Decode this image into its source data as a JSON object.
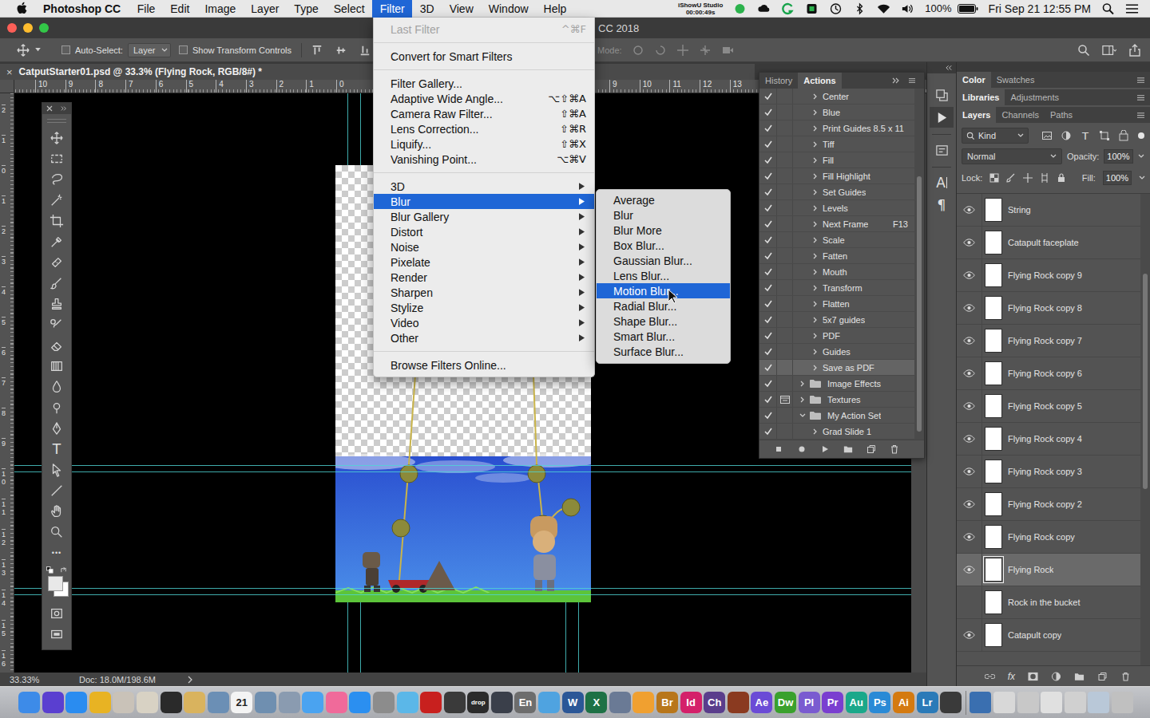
{
  "menubar": {
    "app_name": "Photoshop CC",
    "menus": [
      {
        "label": "File",
        "selected": false
      },
      {
        "label": "Edit",
        "selected": false
      },
      {
        "label": "Image",
        "selected": false
      },
      {
        "label": "Layer",
        "selected": false
      },
      {
        "label": "Type",
        "selected": false
      },
      {
        "label": "Select",
        "selected": false
      },
      {
        "label": "Filter",
        "selected": true
      },
      {
        "label": "3D",
        "selected": false
      },
      {
        "label": "View",
        "selected": false
      },
      {
        "label": "Window",
        "selected": false
      },
      {
        "label": "Help",
        "selected": false
      }
    ],
    "recorder": {
      "name": "iShowU Studio",
      "time": "00:00:49s"
    },
    "battery": "100%",
    "clock": "Fri Sep 21 12:55 PM"
  },
  "app_window": {
    "title": "CC 2018"
  },
  "options_bar": {
    "auto_select_label": "Auto-Select:",
    "auto_select_checked": false,
    "auto_select_target": "Layer",
    "transform_controls_label": "Show Transform Controls",
    "transform_controls_checked": false,
    "mode_label": "Mode:"
  },
  "document": {
    "tab_title": "CatputStarter01.psd @ 33.3% (Flying Rock, RGB/8#) *",
    "close": "×"
  },
  "rulers": {
    "top_left": [
      "10",
      "9",
      "8",
      "7",
      "6",
      "5",
      "4",
      "3",
      "2",
      "1",
      "0"
    ],
    "top_right": [
      "9",
      "10",
      "11",
      "12",
      "13"
    ],
    "left": [
      "2",
      "1",
      "0",
      "1",
      "2",
      "3",
      "4",
      "5",
      "6",
      "7",
      "8",
      "9",
      "10",
      "11",
      "12",
      "13",
      "14",
      "15",
      "16"
    ]
  },
  "toolbox": {
    "type_tool": "T",
    "more_tools": "•••"
  },
  "status_bar": {
    "zoom": "33.33%",
    "doc_size": "Doc: 18.0M/198.6M"
  },
  "filter_menu": {
    "items": [
      {
        "kind": "item",
        "label": "Last Filter",
        "shortcut": "^⌘F",
        "disabled": true,
        "submenu": false,
        "selected": false
      },
      {
        "kind": "separator"
      },
      {
        "kind": "item",
        "label": "Convert for Smart Filters",
        "shortcut": "",
        "disabled": false,
        "submenu": false,
        "selected": false
      },
      {
        "kind": "separator"
      },
      {
        "kind": "item",
        "label": "Filter Gallery...",
        "shortcut": "",
        "disabled": false,
        "submenu": false,
        "selected": false
      },
      {
        "kind": "item",
        "label": "Adaptive Wide Angle...",
        "shortcut": "⌥⇧⌘A",
        "disabled": false,
        "submenu": false,
        "selected": false
      },
      {
        "kind": "item",
        "label": "Camera Raw Filter...",
        "shortcut": "⇧⌘A",
        "disabled": false,
        "submenu": false,
        "selected": false
      },
      {
        "kind": "item",
        "label": "Lens Correction...",
        "shortcut": "⇧⌘R",
        "disabled": false,
        "submenu": false,
        "selected": false
      },
      {
        "kind": "item",
        "label": "Liquify...",
        "shortcut": "⇧⌘X",
        "disabled": false,
        "submenu": false,
        "selected": false
      },
      {
        "kind": "item",
        "label": "Vanishing Point...",
        "shortcut": "⌥⌘V",
        "disabled": false,
        "submenu": false,
        "selected": false
      },
      {
        "kind": "separator"
      },
      {
        "kind": "item",
        "label": "3D",
        "shortcut": "",
        "disabled": false,
        "submenu": true,
        "selected": false
      },
      {
        "kind": "item",
        "label": "Blur",
        "shortcut": "",
        "disabled": false,
        "submenu": true,
        "selected": true
      },
      {
        "kind": "item",
        "label": "Blur Gallery",
        "shortcut": "",
        "disabled": false,
        "submenu": true,
        "selected": false
      },
      {
        "kind": "item",
        "label": "Distort",
        "shortcut": "",
        "disabled": false,
        "submenu": true,
        "selected": false
      },
      {
        "kind": "item",
        "label": "Noise",
        "shortcut": "",
        "disabled": false,
        "submenu": true,
        "selected": false
      },
      {
        "kind": "item",
        "label": "Pixelate",
        "shortcut": "",
        "disabled": false,
        "submenu": true,
        "selected": false
      },
      {
        "kind": "item",
        "label": "Render",
        "shortcut": "",
        "disabled": false,
        "submenu": true,
        "selected": false
      },
      {
        "kind": "item",
        "label": "Sharpen",
        "shortcut": "",
        "disabled": false,
        "submenu": true,
        "selected": false
      },
      {
        "kind": "item",
        "label": "Stylize",
        "shortcut": "",
        "disabled": false,
        "submenu": true,
        "selected": false
      },
      {
        "kind": "item",
        "label": "Video",
        "shortcut": "",
        "disabled": false,
        "submenu": true,
        "selected": false
      },
      {
        "kind": "item",
        "label": "Other",
        "shortcut": "",
        "disabled": false,
        "submenu": true,
        "selected": false
      },
      {
        "kind": "separator"
      },
      {
        "kind": "item",
        "label": "Browse Filters Online...",
        "shortcut": "",
        "disabled": false,
        "submenu": false,
        "selected": false
      }
    ]
  },
  "blur_submenu": {
    "items": [
      {
        "label": "Average",
        "selected": false
      },
      {
        "label": "Blur",
        "selected": false
      },
      {
        "label": "Blur More",
        "selected": false
      },
      {
        "label": "Box Blur...",
        "selected": false
      },
      {
        "label": "Gaussian Blur...",
        "selected": false
      },
      {
        "label": "Lens Blur...",
        "selected": false
      },
      {
        "label": "Motion Blur...",
        "selected": true
      },
      {
        "label": "Radial Blur...",
        "selected": false
      },
      {
        "label": "Shape Blur...",
        "selected": false
      },
      {
        "label": "Smart Blur...",
        "selected": false
      },
      {
        "label": "Surface Blur...",
        "selected": false
      }
    ]
  },
  "actions_panel": {
    "tabs": [
      {
        "label": "History",
        "selected": false
      },
      {
        "label": "Actions",
        "selected": true
      }
    ],
    "rows": [
      {
        "label": "Center",
        "kind": "action",
        "checked": true,
        "dialog": false,
        "expanded": false,
        "shortcut": "",
        "selected": false
      },
      {
        "label": "Blue",
        "kind": "action",
        "checked": true,
        "dialog": false,
        "expanded": false,
        "shortcut": "",
        "selected": false
      },
      {
        "label": "Print Guides 8.5 x 11",
        "kind": "action",
        "checked": true,
        "dialog": false,
        "expanded": false,
        "shortcut": "",
        "selected": false
      },
      {
        "label": "Tiff",
        "kind": "action",
        "checked": true,
        "dialog": false,
        "expanded": false,
        "shortcut": "",
        "selected": false
      },
      {
        "label": "Fill",
        "kind": "action",
        "checked": true,
        "dialog": false,
        "expanded": false,
        "shortcut": "",
        "selected": false
      },
      {
        "label": "Fill Highlight",
        "kind": "action",
        "checked": true,
        "dialog": false,
        "expanded": false,
        "shortcut": "",
        "selected": false
      },
      {
        "label": "Set Guides",
        "kind": "action",
        "checked": true,
        "dialog": false,
        "expanded": false,
        "shortcut": "",
        "selected": false
      },
      {
        "label": "Levels",
        "kind": "action",
        "checked": true,
        "dialog": false,
        "expanded": false,
        "shortcut": "",
        "selected": false
      },
      {
        "label": "Next Frame",
        "kind": "action",
        "checked": true,
        "dialog": false,
        "expanded": false,
        "shortcut": "F13",
        "selected": false
      },
      {
        "label": "Scale",
        "kind": "action",
        "checked": true,
        "dialog": false,
        "expanded": false,
        "shortcut": "",
        "selected": false
      },
      {
        "label": "Fatten",
        "kind": "action",
        "checked": true,
        "dialog": false,
        "expanded": false,
        "shortcut": "",
        "selected": false
      },
      {
        "label": "Mouth",
        "kind": "action",
        "checked": true,
        "dialog": false,
        "expanded": false,
        "shortcut": "",
        "selected": false
      },
      {
        "label": "Transform",
        "kind": "action",
        "checked": true,
        "dialog": false,
        "expanded": false,
        "shortcut": "",
        "selected": false
      },
      {
        "label": "Flatten",
        "kind": "action",
        "checked": true,
        "dialog": false,
        "expanded": false,
        "shortcut": "",
        "selected": false
      },
      {
        "label": "5x7 guides",
        "kind": "action",
        "checked": true,
        "dialog": false,
        "expanded": false,
        "shortcut": "",
        "selected": false
      },
      {
        "label": "PDF",
        "kind": "action",
        "checked": true,
        "dialog": false,
        "expanded": false,
        "shortcut": "",
        "selected": false
      },
      {
        "label": "Guides",
        "kind": "action",
        "checked": true,
        "dialog": false,
        "expanded": false,
        "shortcut": "",
        "selected": false
      },
      {
        "label": "Save as PDF",
        "kind": "action",
        "checked": true,
        "dialog": false,
        "expanded": false,
        "shortcut": "",
        "selected": true
      },
      {
        "label": "Image Effects",
        "kind": "set",
        "checked": true,
        "dialog": false,
        "expanded": false,
        "shortcut": "",
        "selected": false
      },
      {
        "label": "Textures",
        "kind": "set",
        "checked": true,
        "dialog": true,
        "expanded": false,
        "shortcut": "",
        "selected": false
      },
      {
        "label": "My Action Set",
        "kind": "set",
        "checked": true,
        "dialog": false,
        "expanded": true,
        "shortcut": "",
        "selected": false
      },
      {
        "label": "Grad Slide 1",
        "kind": "action",
        "checked": true,
        "dialog": false,
        "expanded": false,
        "shortcut": "",
        "selected": false
      }
    ]
  },
  "icon_column": {
    "character": "A",
    "paragraph": "¶"
  },
  "right_panel": {
    "tab_groups": [
      {
        "tabs": [
          {
            "label": "Color",
            "selected": true
          },
          {
            "label": "Swatches",
            "selected": false
          }
        ]
      },
      {
        "tabs": [
          {
            "label": "Libraries",
            "selected": true
          },
          {
            "label": "Adjustments",
            "selected": false
          }
        ]
      },
      {
        "tabs": [
          {
            "label": "Layers",
            "selected": true
          },
          {
            "label": "Channels",
            "selected": false
          },
          {
            "label": "Paths",
            "selected": false
          }
        ]
      }
    ],
    "filter_label": "Kind",
    "type_filter": "T",
    "blend_mode": "Normal",
    "opacity_label": "Opacity:",
    "opacity": "100%",
    "lock_label": "Lock:",
    "fill_label": "Fill:",
    "fill": "100%",
    "footer_fx": "fx",
    "layers": [
      {
        "name": "String",
        "visible": true,
        "selected": false
      },
      {
        "name": "Catapult faceplate",
        "visible": true,
        "selected": false
      },
      {
        "name": "Flying Rock copy 9",
        "visible": true,
        "selected": false
      },
      {
        "name": "Flying Rock copy 8",
        "visible": true,
        "selected": false
      },
      {
        "name": "Flying Rock copy 7",
        "visible": true,
        "selected": false
      },
      {
        "name": "Flying Rock copy 6",
        "visible": true,
        "selected": false
      },
      {
        "name": "Flying Rock copy 5",
        "visible": true,
        "selected": false
      },
      {
        "name": "Flying Rock copy 4",
        "visible": true,
        "selected": false
      },
      {
        "name": "Flying Rock copy 3",
        "visible": true,
        "selected": false
      },
      {
        "name": "Flying Rock copy 2",
        "visible": true,
        "selected": false
      },
      {
        "name": "Flying Rock copy",
        "visible": true,
        "selected": false
      },
      {
        "name": "Flying Rock",
        "visible": true,
        "selected": true
      },
      {
        "name": "Rock in the bucket",
        "visible": false,
        "selected": false
      },
      {
        "name": "Catapult copy",
        "visible": true,
        "selected": false
      }
    ]
  },
  "dock": {
    "apps": [
      {
        "label": "",
        "color": "#3d8be8"
      },
      {
        "label": "",
        "color": "#5a3fd0"
      },
      {
        "label": "",
        "color": "#2a8cf0"
      },
      {
        "label": "",
        "color": "#e8b323"
      },
      {
        "label": "",
        "color": "#c9c2b8"
      },
      {
        "label": "",
        "color": "#d8d2c4"
      },
      {
        "label": "",
        "color": "#2a2a2a"
      },
      {
        "label": "",
        "color": "#d9b35e"
      },
      {
        "label": "",
        "color": "#6b8fb5"
      },
      {
        "label": "21",
        "color": "#f4f4f4"
      },
      {
        "label": "",
        "color": "#6f8fb0"
      },
      {
        "label": "",
        "color": "#8a9bb0"
      },
      {
        "label": "",
        "color": "#4aa3f0"
      },
      {
        "label": "",
        "color": "#f06a9a"
      },
      {
        "label": "",
        "color": "#2b8ff0"
      },
      {
        "label": "",
        "color": "#8c8c8c"
      },
      {
        "label": "",
        "color": "#5bb7e8"
      },
      {
        "label": "",
        "color": "#c8201e"
      },
      {
        "label": "",
        "color": "#3a3a3a"
      },
      {
        "label": "drop",
        "color": "#2b2b2b"
      },
      {
        "label": "",
        "color": "#3a3f4a"
      },
      {
        "label": "En",
        "color": "#6d6d6d"
      },
      {
        "label": "",
        "color": "#4fa3e0"
      },
      {
        "label": "W",
        "color": "#2b5797"
      },
      {
        "label": "X",
        "color": "#1e7145"
      },
      {
        "label": "",
        "color": "#6a7a95"
      },
      {
        "label": "",
        "color": "#f0a030"
      },
      {
        "label": "Br",
        "color": "#b8761a"
      },
      {
        "label": "Id",
        "color": "#d4206a"
      },
      {
        "label": "Ch",
        "color": "#5a3d8c"
      },
      {
        "label": "",
        "color": "#8a3a20"
      },
      {
        "label": "Ae",
        "color": "#6b4bd6"
      },
      {
        "label": "Dw",
        "color": "#3aa12d"
      },
      {
        "label": "Pl",
        "color": "#7a5bd0"
      },
      {
        "label": "Pr",
        "color": "#7a3ed0"
      },
      {
        "label": "Au",
        "color": "#1aa88a"
      },
      {
        "label": "Ps",
        "color": "#2a8ad6"
      },
      {
        "label": "Ai",
        "color": "#d47a10"
      },
      {
        "label": "Lr",
        "color": "#2a7ab8"
      },
      {
        "label": "",
        "color": "#3a3a3a"
      }
    ],
    "stacks": [
      {
        "label": "",
        "color": "#3a6fb0"
      },
      {
        "label": "",
        "color": "#d8d8d8"
      },
      {
        "label": "",
        "color": "#c8c8c8"
      },
      {
        "label": "",
        "color": "#e0e0e0"
      },
      {
        "label": "",
        "color": "#d0d0d0"
      },
      {
        "label": "",
        "color": "#b9c8d8"
      },
      {
        "label": "",
        "color": "#c0c0c0"
      }
    ]
  }
}
